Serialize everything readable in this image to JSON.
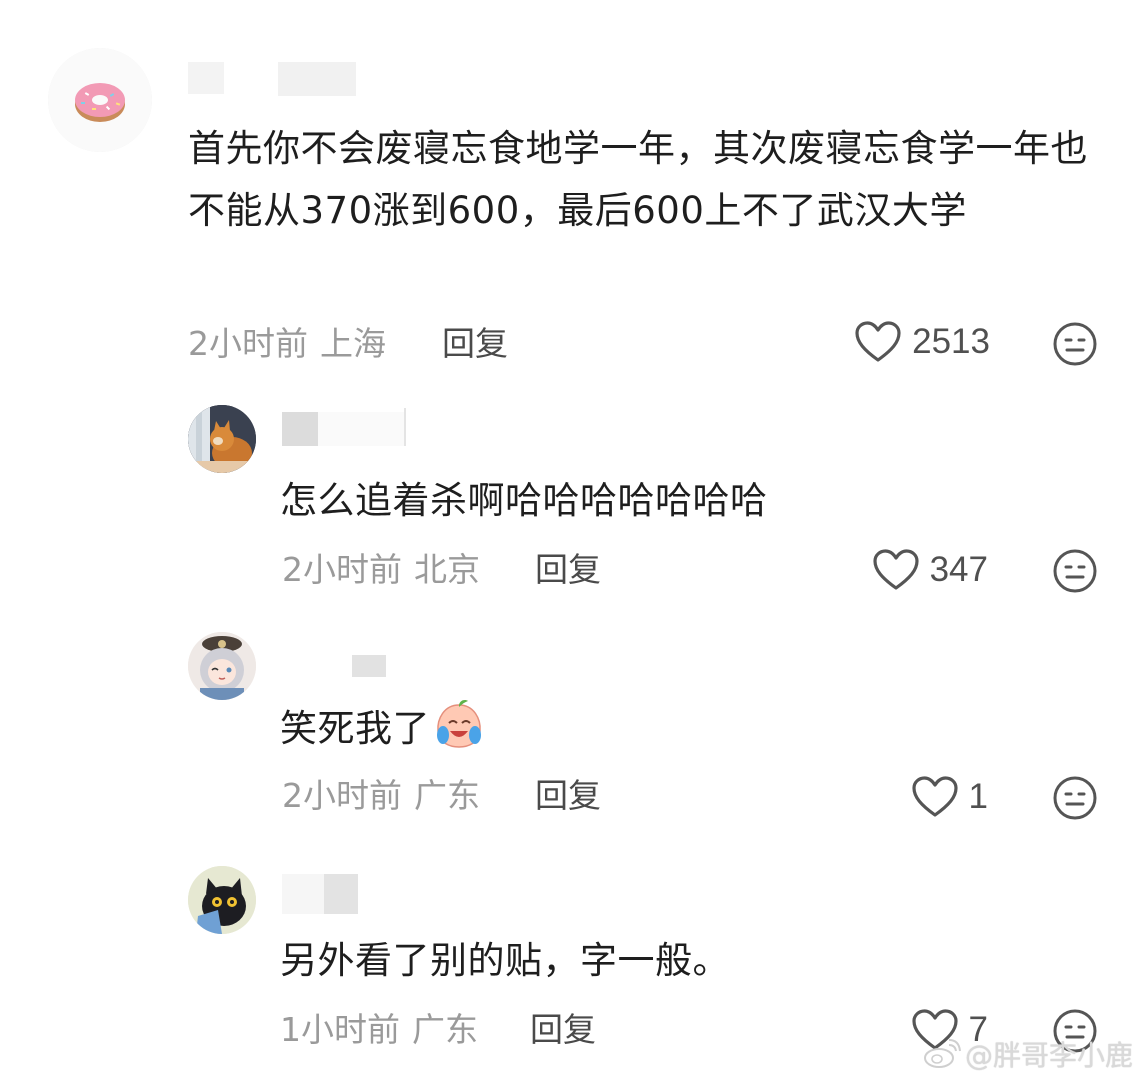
{
  "comments": [
    {
      "text": "首先你不会废寝忘食地学一年，其次废寝忘食学一年也不能从370涨到600，最后600上不了武汉大学",
      "time": "2小时前",
      "location": "上海",
      "reply_label": "回复",
      "likes": "2513",
      "avatar_icon": "donut-icon"
    },
    {
      "text": "怎么追着杀啊哈哈哈哈哈哈哈",
      "time": "2小时前",
      "location": "北京",
      "reply_label": "回复",
      "likes": "347",
      "avatar_icon": "cat-photo-avatar"
    },
    {
      "text": "笑死我了",
      "emoji": "laughing-crying-peach-emoji",
      "time": "2小时前",
      "location": "广东",
      "reply_label": "回复",
      "likes": "1",
      "avatar_icon": "anime-girl-avatar"
    },
    {
      "text": "另外看了别的贴，字一般。",
      "time": "1小时前",
      "location": "广东",
      "reply_label": "回复",
      "likes": "7",
      "avatar_icon": "black-cat-avatar"
    }
  ],
  "watermark": {
    "text": "@胖哥李小鹿",
    "icon": "weibo-logo-icon"
  },
  "colors": {
    "meta_gray": "#9a9a9a",
    "text_dark": "#1e1e1e",
    "icon_gray": "#555555"
  }
}
